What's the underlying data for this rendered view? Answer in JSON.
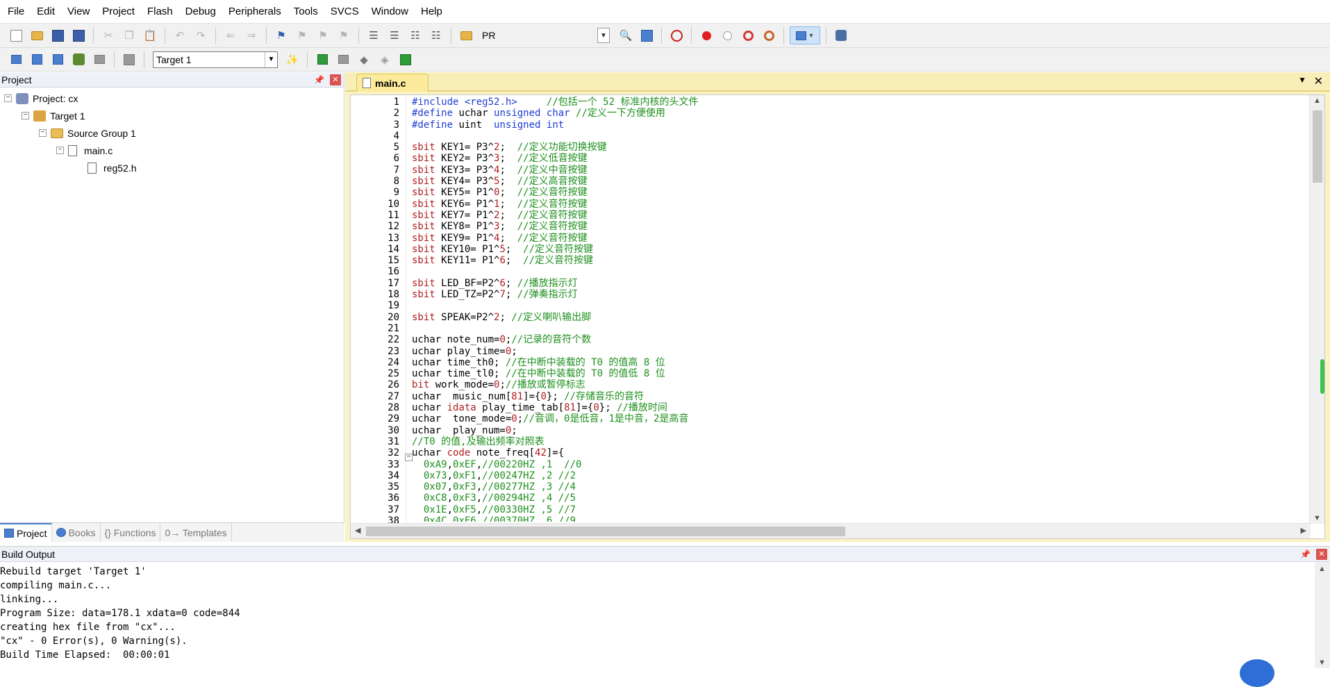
{
  "menu": [
    "File",
    "Edit",
    "View",
    "Project",
    "Flash",
    "Debug",
    "Peripherals",
    "Tools",
    "SVCS",
    "Window",
    "Help"
  ],
  "toolbar1": {
    "find_value": "PR"
  },
  "toolbar2": {
    "target_value": "Target 1"
  },
  "project_panel": {
    "title": "Project",
    "tree": {
      "project": "Project: cx",
      "target": "Target 1",
      "group": "Source Group 1",
      "file": "main.c",
      "header": "reg52.h"
    },
    "tabs": [
      "Project",
      "Books",
      "{} Functions",
      "0→ Templates"
    ]
  },
  "editor": {
    "tab_name": "main.c",
    "line_numbers": [
      "1",
      "2",
      "3",
      "4",
      "5",
      "6",
      "7",
      "8",
      "9",
      "10",
      "11",
      "12",
      "13",
      "14",
      "15",
      "16",
      "17",
      "18",
      "19",
      "20",
      "21",
      "22",
      "23",
      "24",
      "25",
      "26",
      "27",
      "28",
      "29",
      "30",
      "31",
      "32",
      "33",
      "34",
      "35",
      "36",
      "37",
      "38"
    ],
    "code": [
      "#include <reg52.h>     //包括一个 52 标准内核的头文件",
      "#define uchar unsigned char //定义一下方便使用",
      "#define uint  unsigned int",
      "",
      "sbit KEY1= P3^2;  //定义功能切换按键",
      "sbit KEY2= P3^3;  //定义低音按键",
      "sbit KEY3= P3^4;  //定义中音按键",
      "sbit KEY4= P3^5;  //定义高音按键",
      "sbit KEY5= P1^0;  //定义音符按键",
      "sbit KEY6= P1^1;  //定义音符按键",
      "sbit KEY7= P1^2;  //定义音符按键",
      "sbit KEY8= P1^3;  //定义音符按键",
      "sbit KEY9= P1^4;  //定义音符按键",
      "sbit KEY10= P1^5;  //定义音符按键",
      "sbit KEY11= P1^6;  //定义音符按键",
      "",
      "sbit LED_BF=P2^6; //播放指示灯",
      "sbit LED_TZ=P2^7; //弹奏指示灯",
      "",
      "sbit SPEAK=P2^2; //定义喇叭输出脚",
      "",
      "uchar note_num=0;//记录的音符个数",
      "uchar play_time=0;",
      "uchar time_th0; //在中断中装载的 T0 的值高 8 位",
      "uchar time_tl0; //在中断中装载的 T0 的值低 8 位",
      "bit work_mode=0;//播放或暂停标志",
      "uchar  music_num[81]={0}; //存储音乐的音符",
      "uchar idata play_time_tab[81]={0}; //播放时间",
      "uchar  tone_mode=0;//音调，0是低音，1是中音，2是高音",
      "uchar  play_num=0;",
      "//T0 的值,及输出频率对照表",
      "uchar code note_freq[42]={",
      "  0xA9,0xEF,//00220HZ ,1  //0",
      "  0x73,0xF1,//00247HZ ,2 //2",
      "  0x07,0xF3,//00277HZ ,3 //4",
      "  0xC8,0xF3,//00294HZ ,4 //5",
      "  0x1E,0xF5,//00330HZ ,5 //7",
      "  0x4C,0xF6,//00370HZ ,6 //9"
    ]
  },
  "build_output": {
    "title": "Build Output",
    "lines": [
      "Rebuild target 'Target 1'",
      "compiling main.c...",
      "linking...",
      "Program Size: data=178.1 xdata=0 code=844",
      "creating hex file from \"cx\"...",
      "\"cx\" - 0 Error(s), 0 Warning(s).",
      "Build Time Elapsed:  00:00:01"
    ]
  }
}
